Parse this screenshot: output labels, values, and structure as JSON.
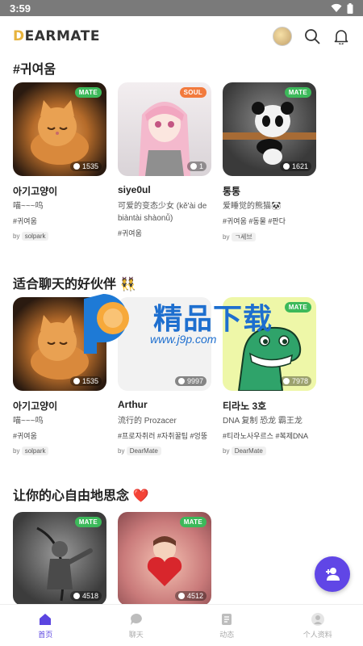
{
  "status": {
    "time": "3:59"
  },
  "header": {
    "logo_prefix": "D",
    "logo_rest": "EARMATE"
  },
  "sections": [
    {
      "title": "#귀여움",
      "cards": [
        {
          "name": "아기고양이",
          "desc": "喵~~~呜",
          "tags": "#귀여움",
          "by": "by",
          "author": "solpark",
          "count": "1535",
          "badge": "MATE",
          "badge_color": "#3cb95a",
          "art": "kitten"
        },
        {
          "name": "siye0ul",
          "desc": "可爱的变态少女 (kě'ài de biàntài shàonǚ)",
          "tags": "#귀여움",
          "by": "",
          "author": "",
          "count": "1",
          "badge": "SOUL",
          "badge_color": "#f27a3d",
          "art": "anime"
        },
        {
          "name": "통통",
          "desc": "爱睡觉的熊猫🐼",
          "tags": "#귀여움 #동물 #판다",
          "by": "by",
          "author": "ㄱ세브",
          "count": "1621",
          "badge": "MATE",
          "badge_color": "#3cb95a",
          "art": "panda"
        }
      ]
    },
    {
      "title": "适合聊天的好伙伴 👯",
      "cards": [
        {
          "name": "아기고양이",
          "desc": "喵~~~呜",
          "tags": "#귀여움",
          "by": "by",
          "author": "solpark",
          "count": "1535",
          "badge": "",
          "badge_color": "#3cb95a",
          "art": "kitten"
        },
        {
          "name": "Arthur",
          "desc": "流行的 Prozacer",
          "tags": "#프로자취러 #자취꿀팁 #엉뚱",
          "by": "by",
          "author": "DearMate",
          "count": "9997",
          "badge": "",
          "badge_color": "#3cb95a",
          "art": "blank"
        },
        {
          "name": "티라노 3호",
          "desc": "DNA 复制 恐龙 霸王龙",
          "tags": "#티라노사우르스 #복제DNA",
          "by": "by",
          "author": "DearMate",
          "count": "7978",
          "badge": "MATE",
          "badge_color": "#3cb95a",
          "art": "dino"
        }
      ]
    },
    {
      "title": "让你的心自由地思念 ❤️",
      "cards": [
        {
          "count": "4518",
          "badge": "MATE",
          "badge_color": "#3cb95a",
          "art": "warrior"
        },
        {
          "count": "4512",
          "badge": "MATE",
          "badge_color": "#3cb95a",
          "art": "heart"
        }
      ]
    }
  ],
  "watermark": {
    "text": "精品下载",
    "url": "www.j9p.com"
  },
  "nav": [
    {
      "label": "首页",
      "icon": "home-icon"
    },
    {
      "label": "聊天",
      "icon": "chat-icon"
    },
    {
      "label": "动态",
      "icon": "feed-icon"
    },
    {
      "label": "个人资料",
      "icon": "profile-icon"
    }
  ],
  "colors": {
    "accent": "#5b45e0",
    "fab": "#6046e6",
    "mate_badge": "#3cb95a",
    "soul_badge": "#f27a3d",
    "status_bar": "#7a7a7a"
  }
}
